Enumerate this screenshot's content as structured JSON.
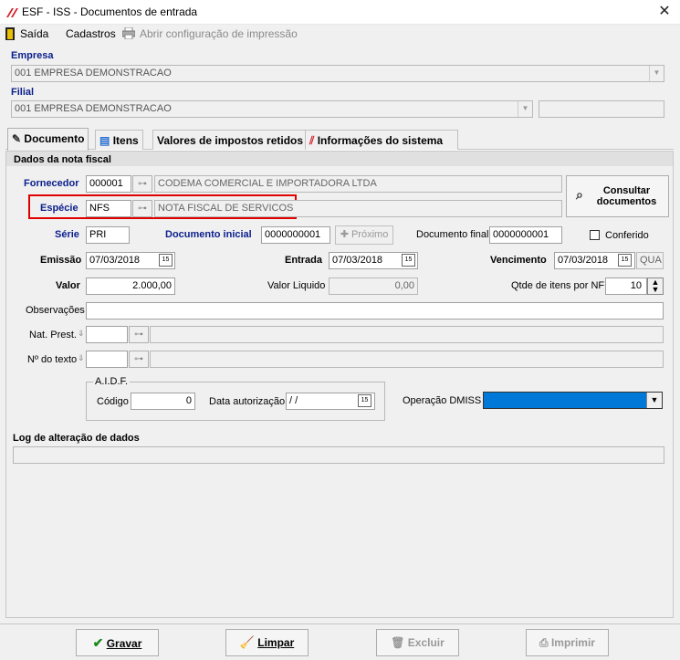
{
  "window": {
    "title": "ESF - ISS - Documentos de entrada",
    "close": "✕"
  },
  "menu": {
    "saida": "Saída",
    "cadastros": "Cadastros",
    "abrir_config": "Abrir configuração de impressão"
  },
  "empresa": {
    "label": "Empresa",
    "value": "001 EMPRESA DEMONSTRACAO"
  },
  "filial": {
    "label": "Filial",
    "value": "001 EMPRESA DEMONSTRACAO",
    "extra": ""
  },
  "tabs": [
    {
      "label": "Documento"
    },
    {
      "label": "Itens"
    },
    {
      "label": "Valores de impostos retidos"
    },
    {
      "label": "Informações do sistema"
    }
  ],
  "section_title": "Dados da nota fiscal",
  "fornecedor": {
    "label": "Fornecedor",
    "code": "000001",
    "name": "CODEMA COMERCIAL E IMPORTADORA LTDA"
  },
  "especie": {
    "label": "Espécie",
    "code": "NFS",
    "name": "NOTA FISCAL DE SERVICOS"
  },
  "consultar_button": {
    "line1": "Consultar",
    "line2": "documentos"
  },
  "serie": {
    "label": "Série",
    "value": "PRI"
  },
  "doc_inicial": {
    "label": "Documento inicial",
    "value": "0000000001"
  },
  "proximo_button": "Próximo",
  "doc_final": {
    "label": "Documento final",
    "value": "0000000001"
  },
  "conferido": {
    "label": "Conferido",
    "checked": false
  },
  "emissao": {
    "label": "Emissão",
    "value": "07/03/2018"
  },
  "entrada": {
    "label": "Entrada",
    "value": "07/03/2018"
  },
  "vencimento": {
    "label": "Vencimento",
    "value": "07/03/2018",
    "weekday": "QUA"
  },
  "valor": {
    "label": "Valor",
    "value": "2.000,00"
  },
  "valor_liquido": {
    "label": "Valor Liquido",
    "value": "0,00"
  },
  "qtde_itens": {
    "label": "Qtde de itens por NF",
    "value": "10"
  },
  "observacoes": {
    "label": "Observações",
    "value": ""
  },
  "nat_prest": {
    "label": "Nat. Prest.",
    "value": ""
  },
  "num_texto": {
    "label": "Nº do texto",
    "value": ""
  },
  "aidf": {
    "legend": "A.I.D.F.",
    "codigo_label": "Código",
    "codigo_value": "0",
    "data_label": "Data autorização",
    "data_value": " / /"
  },
  "operacao_dmiss": {
    "label": "Operação DMISS",
    "value": ""
  },
  "log": {
    "label": "Log de alteração de dados",
    "value": ""
  },
  "buttons": {
    "gravar": "Gravar",
    "limpar": "Limpar",
    "excluir": "Excluir",
    "imprimir": "Imprimir"
  },
  "cal_icon_text": "15",
  "colors": {
    "label_blue": "#0b1f8c",
    "highlight_red": "#e00000",
    "selection_blue": "#0078d7"
  }
}
